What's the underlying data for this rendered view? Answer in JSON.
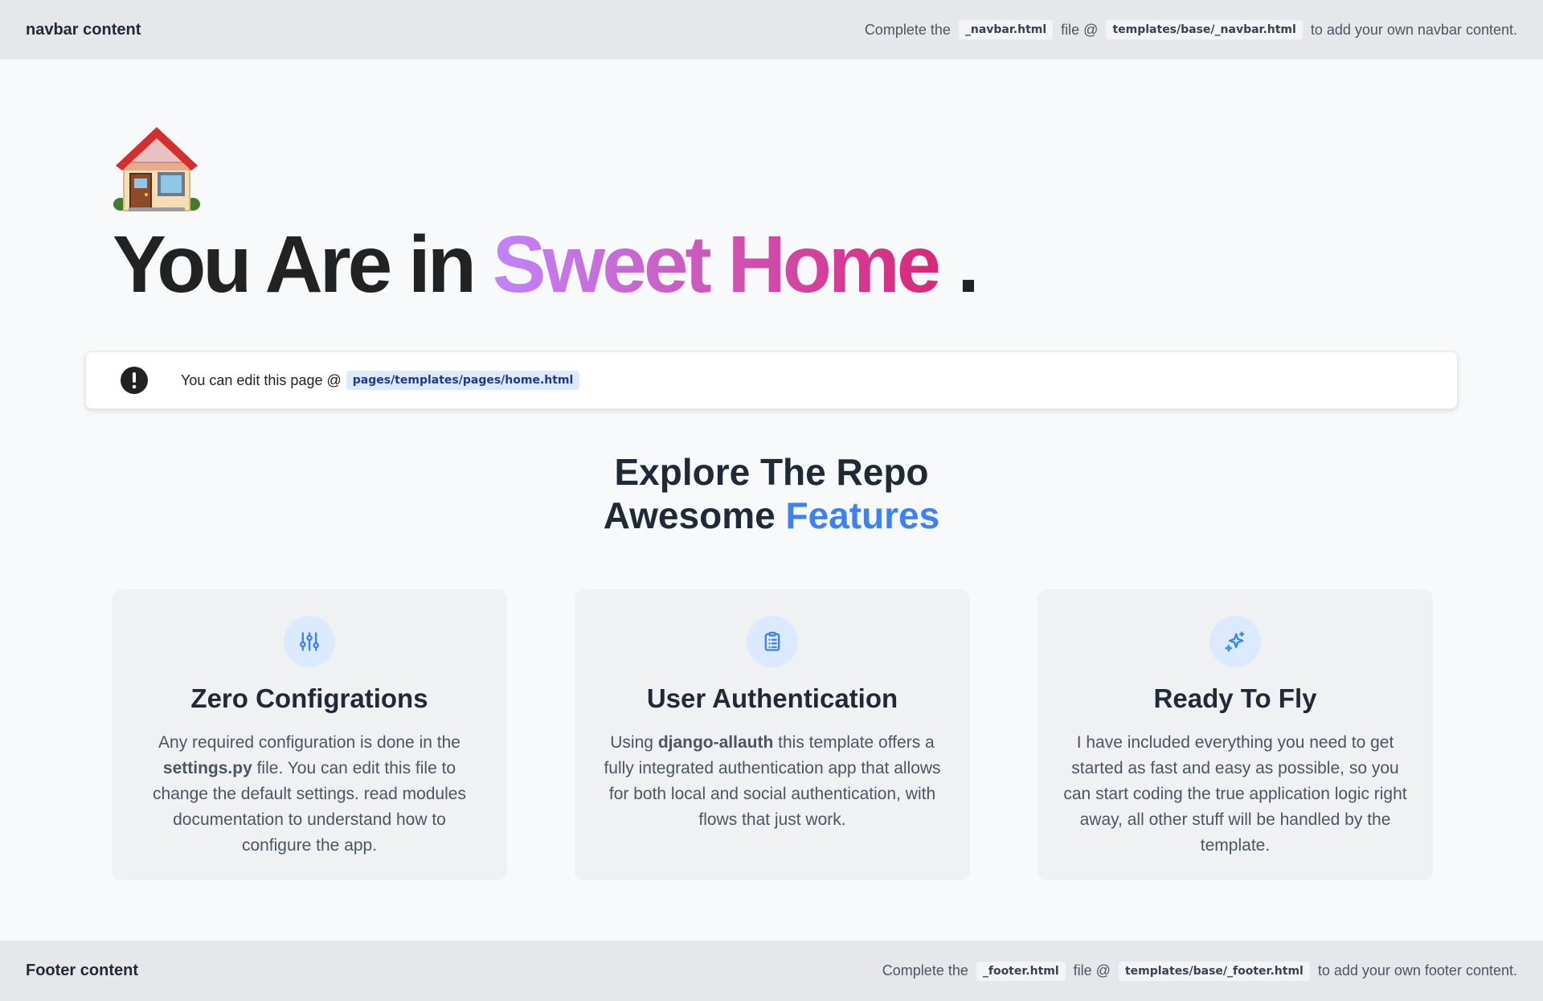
{
  "navbar": {
    "brand": "navbar content",
    "note_prefix": "Complete the",
    "file_name": "_navbar.html",
    "note_mid": "file @",
    "file_path": "templates/base/_navbar.html",
    "note_suffix": "to add your own navbar content."
  },
  "hero": {
    "icon": "house-emoji",
    "title_start": "You Are in",
    "title_highlight": "Sweet Home",
    "title_end": "."
  },
  "alert": {
    "icon": "exclamation-circle-icon",
    "text": "You can edit this page @",
    "path": "pages/templates/pages/home.html"
  },
  "features": {
    "title_line1": "Explore The Repo",
    "title_line2_start": "Awesome",
    "title_line2_accent": "Features",
    "accent_color": "#3b82f6",
    "cards": [
      {
        "icon": "sliders-icon",
        "title": "Zero Configrations",
        "text_before": "Any required configuration is done in the",
        "text_bold": "settings.py",
        "text_after": "file. You can edit this file to change the default settings. read modules documentation to understand how to configure the app."
      },
      {
        "icon": "clipboard-list-icon",
        "title": "User Authentication",
        "text_before": "Using",
        "text_bold": "django-allauth",
        "text_after": "this template offers a fully integrated authentication app that allows for both local and social authentication, with flows that just work."
      },
      {
        "icon": "sparkles-icon",
        "title": "Ready To Fly",
        "text_before": "",
        "text_bold": "",
        "text_after": "I have included everything you need to get started as fast and easy as possible, so you can start coding the true application logic right away, all other stuff will be handled by the template."
      }
    ]
  },
  "footer": {
    "brand": "Footer content",
    "note_prefix": "Complete the",
    "file_name": "_footer.html",
    "note_mid": "file @",
    "file_path": "templates/base/_footer.html",
    "note_suffix": "to add your own footer content."
  }
}
